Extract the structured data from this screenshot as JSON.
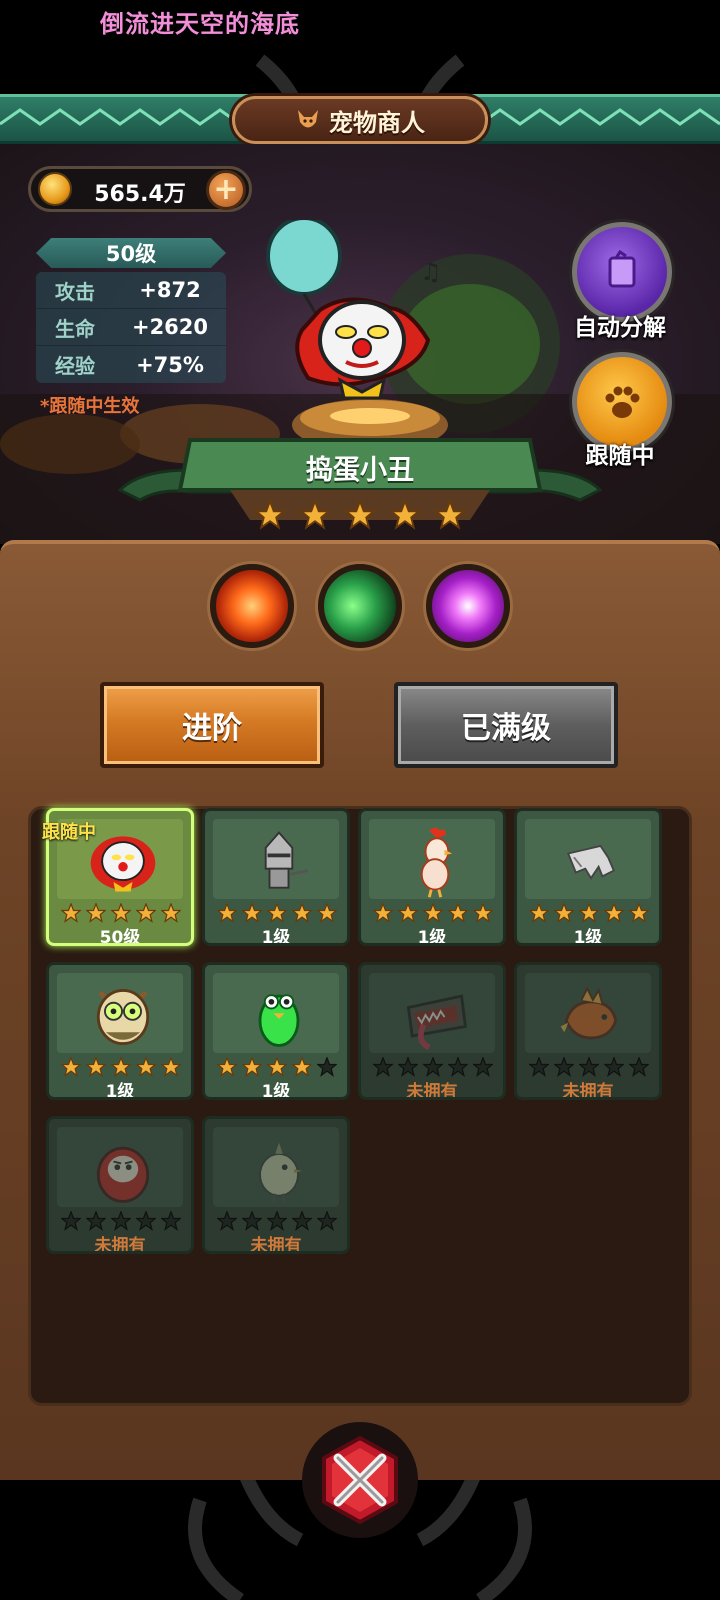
{
  "caption": "倒流进天空的海底",
  "header": {
    "title": "宠物商人",
    "icon": "fox-icon"
  },
  "currency": {
    "value": "565.4万",
    "icon": "coin-icon",
    "add_icon": "plus-icon"
  },
  "pet_stats": {
    "level": "50级",
    "rows": [
      {
        "name": "攻击",
        "value": "+872"
      },
      {
        "name": "生命",
        "value": "+2620"
      },
      {
        "name": "经验",
        "value": "+75%"
      }
    ],
    "note": "*跟随中生效"
  },
  "side_buttons": {
    "auto_decompose": "自动分解",
    "following": "跟随中"
  },
  "pet": {
    "name": "捣蛋小丑",
    "stars": 5,
    "max_stars": 5
  },
  "skills": [
    "fire-skill-icon",
    "claw-skill-icon",
    "chat-skill-icon"
  ],
  "actions": {
    "advance": "进阶",
    "maxed": "已满级"
  },
  "roster": {
    "active_tag": "跟随中",
    "cards": [
      {
        "pet": "clown",
        "stars": 5,
        "level": "50级",
        "owned": true,
        "active": true
      },
      {
        "pet": "knight",
        "stars": 5,
        "level": "1级",
        "owned": true,
        "active": false
      },
      {
        "pet": "chicken",
        "stars": 5,
        "level": "1级",
        "owned": true,
        "active": false
      },
      {
        "pet": "gauntlet",
        "stars": 5,
        "level": "1级",
        "owned": true,
        "active": false
      },
      {
        "pet": "owl",
        "stars": 5,
        "level": "1级",
        "owned": true,
        "active": false
      },
      {
        "pet": "frog",
        "stars": 4,
        "level": "1级",
        "owned": true,
        "active": false
      },
      {
        "pet": "chest-monster",
        "stars": 0,
        "level": "未拥有",
        "owned": false,
        "active": false
      },
      {
        "pet": "dragon",
        "stars": 0,
        "level": "未拥有",
        "owned": false,
        "active": false
      },
      {
        "pet": "daruma",
        "stars": 0,
        "level": "未拥有",
        "owned": false,
        "active": false
      },
      {
        "pet": "bird",
        "stars": 0,
        "level": "未拥有",
        "owned": false,
        "active": false
      }
    ]
  },
  "colors": {
    "panel": "#6e4426",
    "banner": "#2f7e68",
    "star": "#f2b23a",
    "unowned": "#d07a3a"
  }
}
